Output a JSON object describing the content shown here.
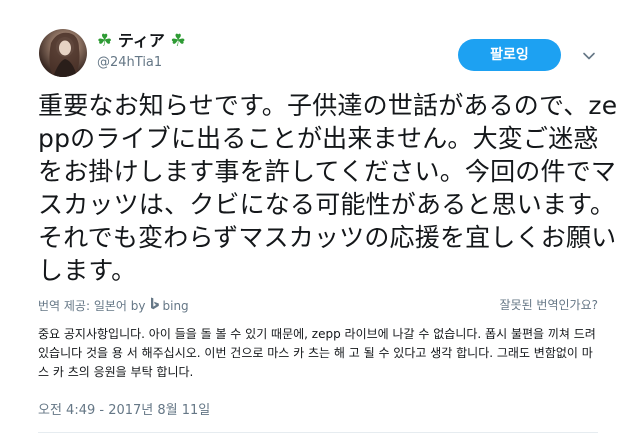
{
  "user": {
    "display_name": "ティア",
    "leading_emoji": "☘",
    "trailing_emoji": "☘",
    "handle": "@24hTia1",
    "avatar_icon": "avatar-photo"
  },
  "actions": {
    "follow_label": "팔로잉",
    "more_icon": "chevron-down-icon"
  },
  "tweet": {
    "text": "重要なお知らせです。子供達の世話があるので、zeppのライブに出ることが出来ません。大変ご迷惑をお掛けします事を許してください。今回の件でマスカッツは、クビになる可能性があると思います。それでも変わらずマスカッツの応援を宜しくお願いします。"
  },
  "translation": {
    "provided_by": "번역 제공: 일본어 by",
    "provider_name": "bing",
    "wrong_link": "잘못된 번역인가요?",
    "text": "중요 공지사항입니다. 아이 들을 돌 볼 수 있기 때문에, zepp 라이브에 나갈 수 없습니다. 폽시 불편을 끼쳐 드려 있습니다 것을 용 서 해주십시오. 이번 건으로 마스 카 츠는 해 고 될 수 있다고 생각 합니다. 그래도 변함없이 마스 카 츠의 응원을 부탁 합니다."
  },
  "meta": {
    "timestamp": "오전 4:49 - 2017년 8월 11일"
  },
  "colors": {
    "accent": "#1da1f2",
    "text": "#14171a",
    "muted": "#657786",
    "clover": "#2e9b34"
  }
}
